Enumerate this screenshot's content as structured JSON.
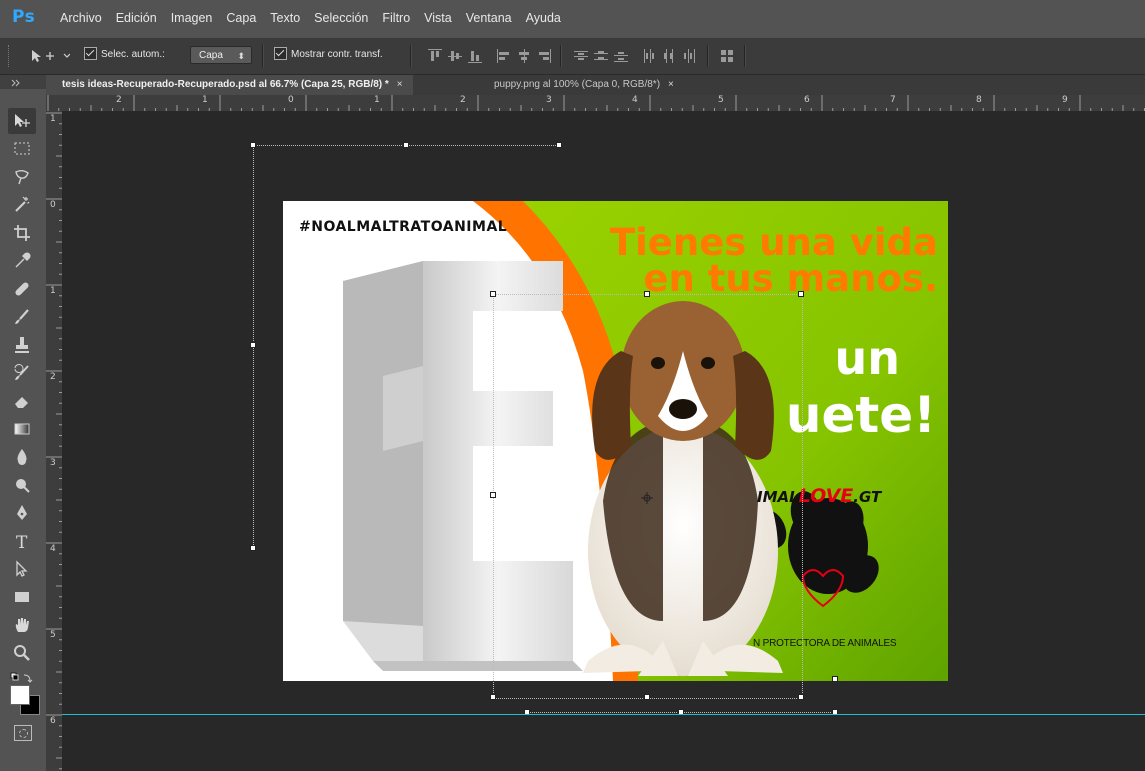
{
  "app": {
    "logo": "Ps",
    "menu": [
      "Archivo",
      "Edición",
      "Imagen",
      "Capa",
      "Texto",
      "Selección",
      "Filtro",
      "Vista",
      "Ventana",
      "Ayuda"
    ]
  },
  "options": {
    "auto_select_label": "Selec. autom.:",
    "auto_select_checked": true,
    "target_value": "Capa",
    "show_transform_label": "Mostrar contr. transf.",
    "show_transform_checked": true
  },
  "tabs": [
    {
      "label": "tesis ideas-Recuperado-Recuperado.psd al 66.7% (Capa 25, RGB/8) *",
      "active": true
    },
    {
      "label": "puppy.png al 100% (Capa 0, RGB/8*)",
      "active": false
    }
  ],
  "rulers": {
    "h_numbers": [
      "2",
      "1",
      "0",
      "1",
      "2",
      "3",
      "4",
      "5",
      "6",
      "7",
      "8",
      "9"
    ],
    "v_numbers": [
      "1",
      "0",
      "1",
      "2",
      "3",
      "4",
      "5",
      "6"
    ]
  },
  "document": {
    "hashtag": "#NOALMALTRATOANIMAL",
    "headline_line1": "Tienes una vida",
    "headline_line2": "en tus manos.",
    "big_line1": "un",
    "big_line2": "uete!",
    "brand_prefix": "IMAL",
    "brand_love": "LOVE",
    "brand_suffix": ".GT",
    "footer": "N PROTECTORA DE ANIMALES",
    "colors": {
      "orange": "#ff7a00",
      "green": "#8cc800",
      "guide": "#22bcd4"
    }
  },
  "tools": [
    "move-tool",
    "marquee-tool",
    "lasso-tool",
    "magic-wand-tool",
    "crop-tool",
    "eyedropper-tool",
    "healing-brush-tool",
    "brush-tool",
    "clone-stamp-tool",
    "history-brush-tool",
    "eraser-tool",
    "gradient-tool",
    "blur-tool",
    "dodge-tool",
    "pen-tool",
    "type-tool",
    "path-selection-tool",
    "rectangle-tool",
    "hand-tool",
    "zoom-tool"
  ]
}
